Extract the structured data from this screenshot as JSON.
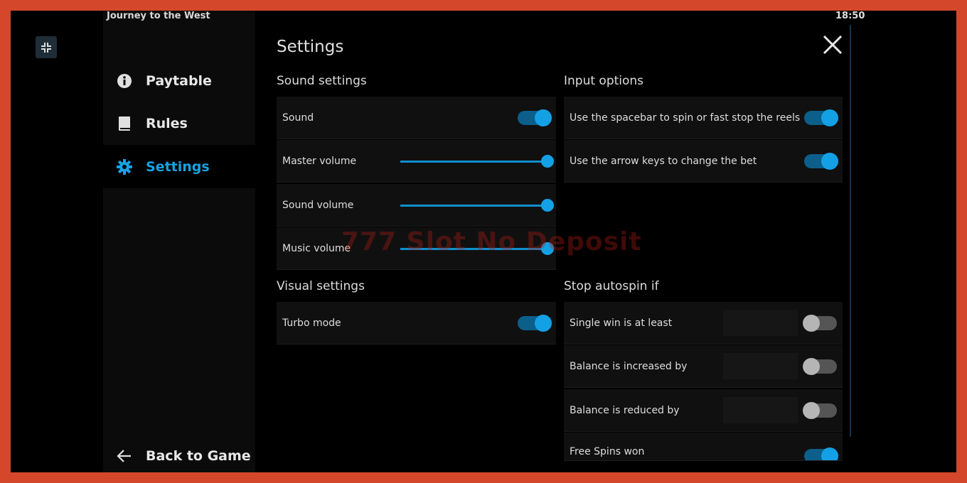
{
  "header": {
    "game_title": "Journey to the West",
    "clock": "18:50"
  },
  "sidebar": {
    "items": [
      {
        "label": "Paytable",
        "icon": "info-icon"
      },
      {
        "label": "Rules",
        "icon": "book-icon"
      },
      {
        "label": "Settings",
        "icon": "gear-icon",
        "active": true
      }
    ],
    "back_label": "Back to Game"
  },
  "main": {
    "title": "Settings",
    "sound": {
      "title": "Sound settings",
      "sound_label": "Sound",
      "sound_on": true,
      "sliders": [
        {
          "label": "Master volume",
          "value": 100
        },
        {
          "label": "Sound volume",
          "value": 100
        },
        {
          "label": "Music volume",
          "value": 100
        }
      ]
    },
    "visual": {
      "title": "Visual settings",
      "turbo_label": "Turbo mode",
      "turbo_on": true
    },
    "input": {
      "title": "Input options",
      "options": [
        {
          "label": "Use the spacebar to spin or fast stop the reels",
          "on": true
        },
        {
          "label": "Use the arrow keys to change the bet",
          "on": true
        }
      ]
    },
    "autospin": {
      "title": "Stop autospin if",
      "options": [
        {
          "label": "Single win is at least",
          "on": false,
          "value": ""
        },
        {
          "label": "Balance is increased by",
          "on": false,
          "value": ""
        },
        {
          "label": "Balance is reduced by",
          "on": false,
          "value": ""
        },
        {
          "label": "Free Spins won",
          "on": true
        }
      ]
    }
  },
  "watermark": "777 Slot No Deposit",
  "colors": {
    "accent": "#14a0e4",
    "border": "#d5472b"
  }
}
